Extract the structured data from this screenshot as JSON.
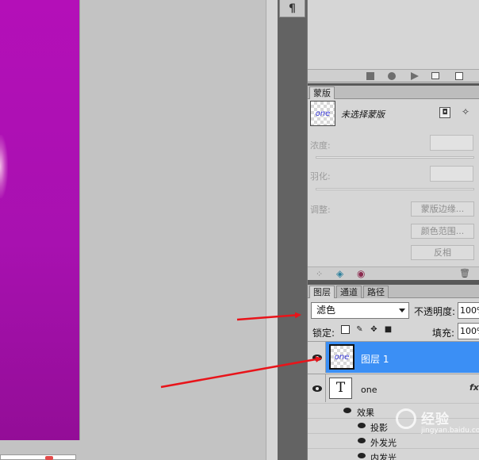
{
  "dock": {
    "paragraph_glyph": "¶"
  },
  "masks_panel": {
    "tab_label": "蒙版",
    "thumb_text": "one",
    "status": "未选择蒙版",
    "density_label": "浓度:",
    "feather_label": "羽化:",
    "adjust_label": "调整:",
    "mask_edge_button": "蒙版边缘...",
    "color_range_button": "颜色范围...",
    "invert_button": "反相"
  },
  "layers_panel": {
    "tabs": [
      {
        "label": "图层"
      },
      {
        "label": "通道"
      },
      {
        "label": "路径"
      }
    ],
    "blend_mode": "滤色",
    "opacity_label": "不透明度:",
    "opacity_value": "100%",
    "lock_label": "锁定:",
    "fill_label": "填充:",
    "fill_value": "100%",
    "layers": [
      {
        "name": "图层 1",
        "thumb_text": "one",
        "selected": true
      },
      {
        "name": "one",
        "thumb_text": "T",
        "fx": "fx"
      }
    ],
    "effects_label": "效果",
    "effects": [
      {
        "label": "投影"
      },
      {
        "label": "外发光"
      },
      {
        "label": "内发光"
      }
    ]
  },
  "watermark": {
    "text": "经验",
    "url": "jingyan.baidu.com"
  },
  "colors": {
    "canvas_magenta": "#b40fb8",
    "selection_blue": "#3b8ff5",
    "arrow_red": "#e8141a",
    "panel_grey": "#d6d6d6"
  },
  "icons": [
    "paragraph-icon",
    "stop-icon",
    "record-icon",
    "play-icon",
    "folder-icon",
    "new-action-icon",
    "mask-load-icon",
    "mask-apply-icon",
    "eye-icon",
    "lock-transparent-icon",
    "lock-brush-icon",
    "lock-move-icon",
    "lock-all-icon",
    "trash-icon"
  ]
}
